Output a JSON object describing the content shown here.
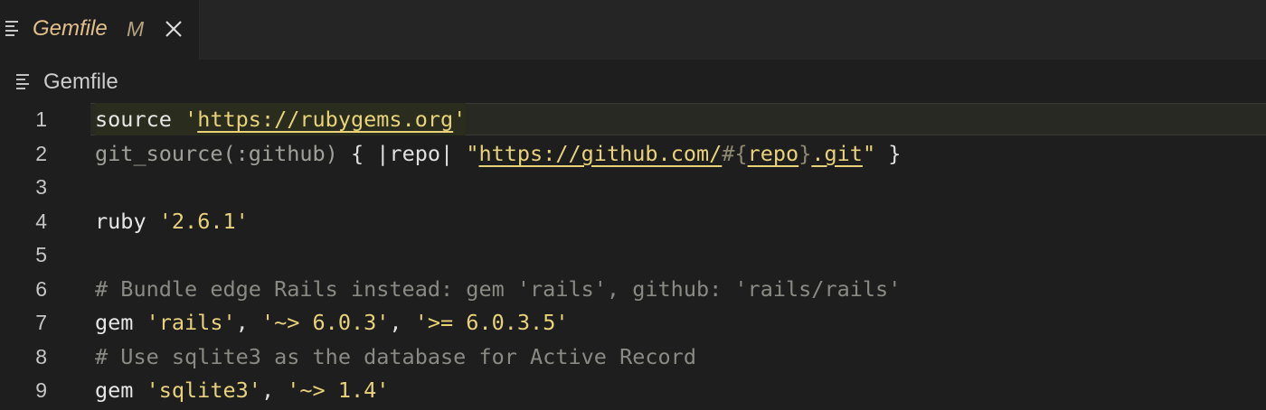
{
  "tab": {
    "title": "Gemfile",
    "status": "M",
    "icon": "lines-icon",
    "close_icon": "close-icon"
  },
  "breadcrumb": {
    "label": "Gemfile",
    "icon": "lines-icon"
  },
  "editor": {
    "current_line": 1,
    "lines": [
      {
        "number": "1",
        "tokens": [
          {
            "t": "source ",
            "k": "kw"
          },
          {
            "t": "'",
            "k": "str"
          },
          {
            "t": "https://rubygems.org",
            "k": "url"
          },
          {
            "t": "'",
            "k": "str"
          }
        ]
      },
      {
        "number": "2",
        "tokens": [
          {
            "t": "git_source",
            "k": "dim"
          },
          {
            "t": "(:github)",
            "k": "dim"
          },
          {
            "t": " { |repo| ",
            "k": "punct"
          },
          {
            "t": "\"",
            "k": "str"
          },
          {
            "t": "https://github.com/",
            "k": "url"
          },
          {
            "t": "#{",
            "k": "interp"
          },
          {
            "t": "repo",
            "k": "url"
          },
          {
            "t": "}",
            "k": "interp"
          },
          {
            "t": ".git",
            "k": "url"
          },
          {
            "t": "\"",
            "k": "str"
          },
          {
            "t": " }",
            "k": "punct"
          }
        ]
      },
      {
        "number": "3",
        "tokens": []
      },
      {
        "number": "4",
        "tokens": [
          {
            "t": "ruby ",
            "k": "kw"
          },
          {
            "t": "'2.6.1'",
            "k": "str"
          }
        ]
      },
      {
        "number": "5",
        "tokens": []
      },
      {
        "number": "6",
        "tokens": [
          {
            "t": "# Bundle edge Rails instead: gem 'rails', github: 'rails/rails'",
            "k": "comment"
          }
        ]
      },
      {
        "number": "7",
        "tokens": [
          {
            "t": "gem ",
            "k": "kw"
          },
          {
            "t": "'rails'",
            "k": "str"
          },
          {
            "t": ", ",
            "k": "punct"
          },
          {
            "t": "'~> 6.0.3'",
            "k": "str"
          },
          {
            "t": ", ",
            "k": "punct"
          },
          {
            "t": "'>= 6.0.3.5'",
            "k": "str"
          }
        ]
      },
      {
        "number": "8",
        "tokens": [
          {
            "t": "# Use sqlite3 as the database for Active Record",
            "k": "comment"
          }
        ]
      },
      {
        "number": "9",
        "tokens": [
          {
            "t": "gem ",
            "k": "kw"
          },
          {
            "t": "'sqlite3'",
            "k": "str"
          },
          {
            "t": ", ",
            "k": "punct"
          },
          {
            "t": "'~> 1.4'",
            "k": "str"
          }
        ]
      }
    ]
  },
  "colors": {
    "background": "#1e1e1e",
    "tab_title": "#e2c08d",
    "string": "#e8d27a",
    "comment": "#8a8a85"
  }
}
